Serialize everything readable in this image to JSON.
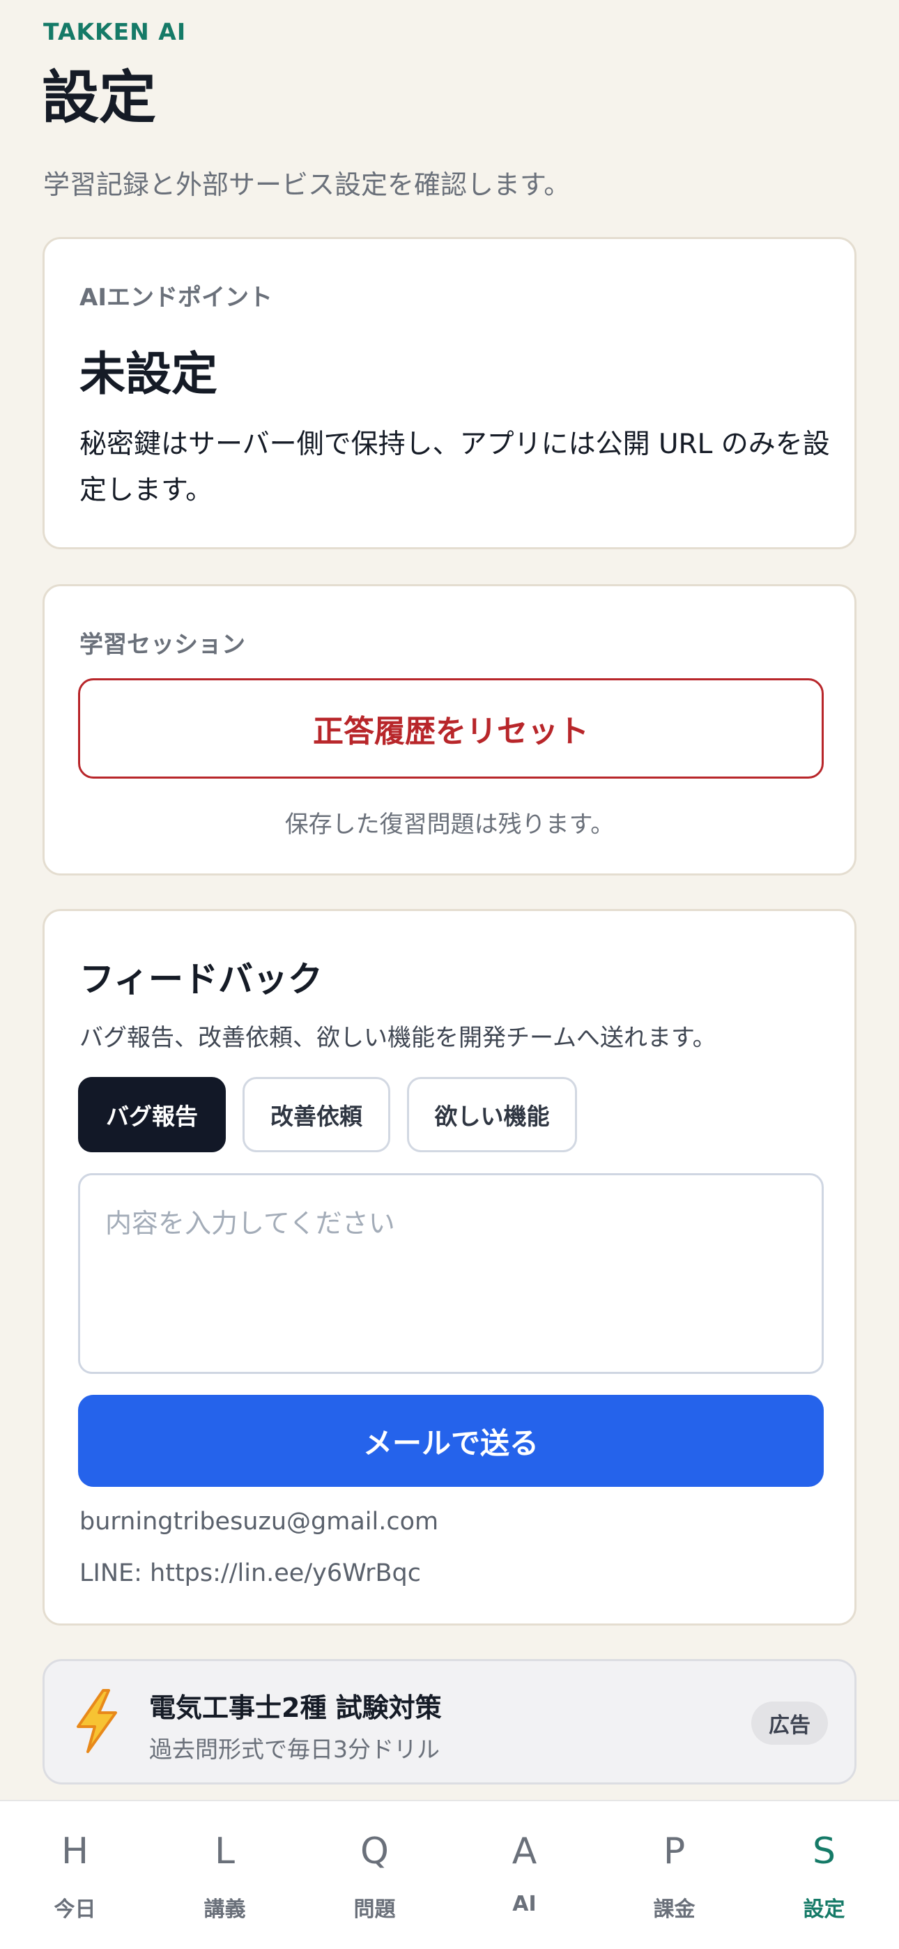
{
  "app": {
    "brand": "TAKKEN AI",
    "title": "設定",
    "subtitle": "学習記録と外部サービス設定を確認します。"
  },
  "ai_endpoint": {
    "label": "AIエンドポイント",
    "value": "未設定",
    "description": "秘密鍵はサーバー側で保持し、アプリには公開 URL のみを設定します。"
  },
  "session": {
    "label": "学習セッション",
    "reset_button": "正答履歴をリセット",
    "note": "保存した復習問題は残ります。"
  },
  "feedback": {
    "title": "フィードバック",
    "description": "バグ報告、改善依頼、欲しい機能を開発チームへ送れます。",
    "categories": [
      {
        "label": "バグ報告",
        "selected": true
      },
      {
        "label": "改善依頼",
        "selected": false
      },
      {
        "label": "欲しい機能",
        "selected": false
      }
    ],
    "input_value": "",
    "input_placeholder": "内容を入力してください",
    "send_button": "メールで送る",
    "email": "burningtribesuzu@gmail.com",
    "line": "LINE: https://lin.ee/y6WrBqc"
  },
  "ad": {
    "icon": "lightning-icon",
    "title": "電気工事士2種 試験対策",
    "subtitle": "過去問形式で毎日3分ドリル",
    "badge": "広告"
  },
  "tabs": [
    {
      "letter": "H",
      "label": "今日",
      "active": false
    },
    {
      "letter": "L",
      "label": "講義",
      "active": false
    },
    {
      "letter": "Q",
      "label": "問題",
      "active": false
    },
    {
      "letter": "A",
      "label": "AI",
      "active": false
    },
    {
      "letter": "P",
      "label": "課金",
      "active": false
    },
    {
      "letter": "S",
      "label": "設定",
      "active": true
    }
  ],
  "colors": {
    "accent": "#157a67",
    "danger": "#b8262a",
    "primary": "#2563eb",
    "background": "#f6f3ec"
  }
}
